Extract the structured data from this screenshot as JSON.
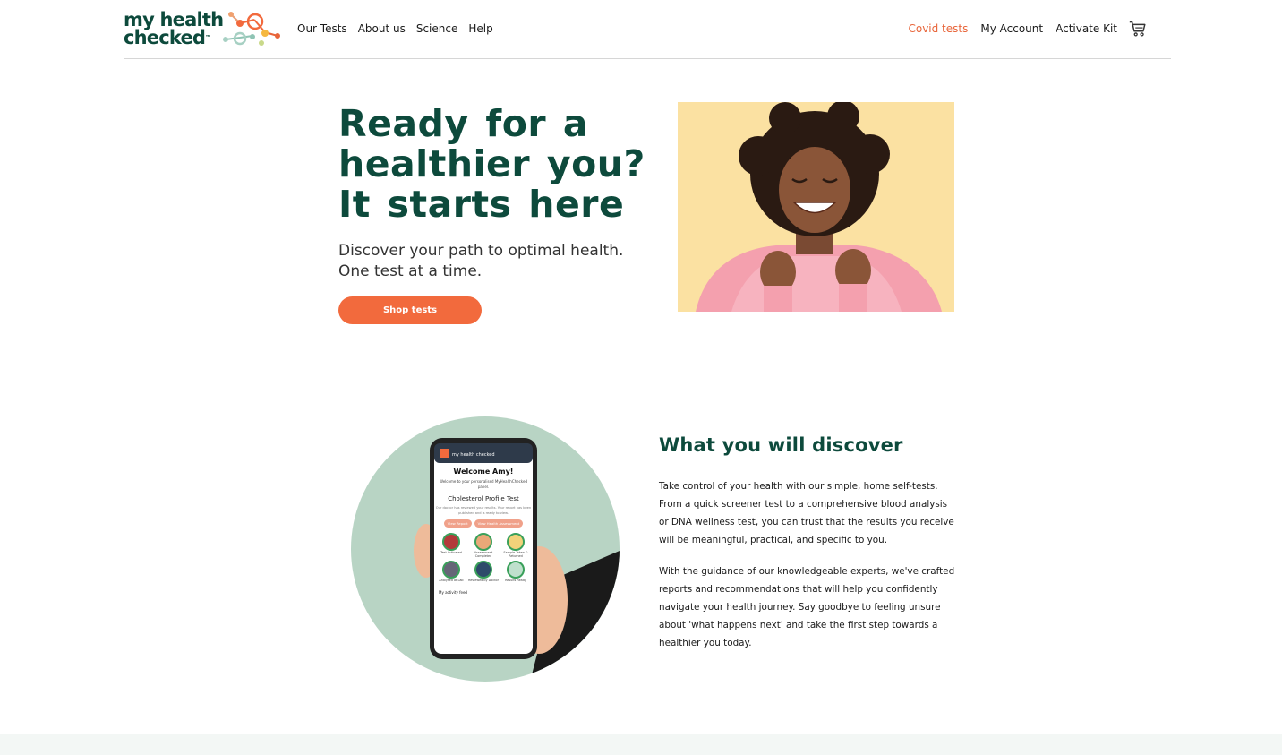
{
  "brand": {
    "logo_line1": "my health",
    "logo_line2": "checked",
    "logo_tm": "™",
    "primary_color": "#0d4a3c",
    "accent_color": "#f26a3d"
  },
  "nav": {
    "left": [
      "Our Tests",
      "About us",
      "Science",
      "Help"
    ],
    "covid": "Covid tests",
    "account": "My Account",
    "activate": "Activate Kit",
    "cart_icon": "cart-icon"
  },
  "hero": {
    "title_line1": "Ready for a",
    "title_line2": "healthier you?",
    "title_line3": "It starts here",
    "subtitle": "Discover your path to optimal health. One test at a time.",
    "cta": "Shop tests"
  },
  "phone": {
    "welcome": "Welcome Amy!",
    "welcome_sub": "Welcome to your personalised MyHealthChecked panel.",
    "test_name": "Cholesterol Profile Test",
    "note": "Our doctor has reviewed your results. Your report has been published and is ready to view.",
    "btn_report": "View Report",
    "btn_assessment": "View Health Assessment",
    "steps": [
      "Test Activated",
      "Assessment Completed",
      "Sample Taken & Returned",
      "Analysed at Lab",
      "Reviewed by Doctor",
      "Results Ready"
    ],
    "feed": "My activity feed"
  },
  "discover": {
    "title": "What you will discover",
    "p1": "Take control of your health with our simple, home self-tests. From a quick screener test to a comprehensive blood analysis or DNA wellness test, you can trust that the results you receive will be meaningful, practical, and specific to you.",
    "p2": "With the guidance of our knowledgeable experts, we've crafted reports and recommendations that will help you confidently navigate your health journey. Say goodbye to feeling unsure about 'what happens next' and take the first step towards a healthier you today."
  }
}
